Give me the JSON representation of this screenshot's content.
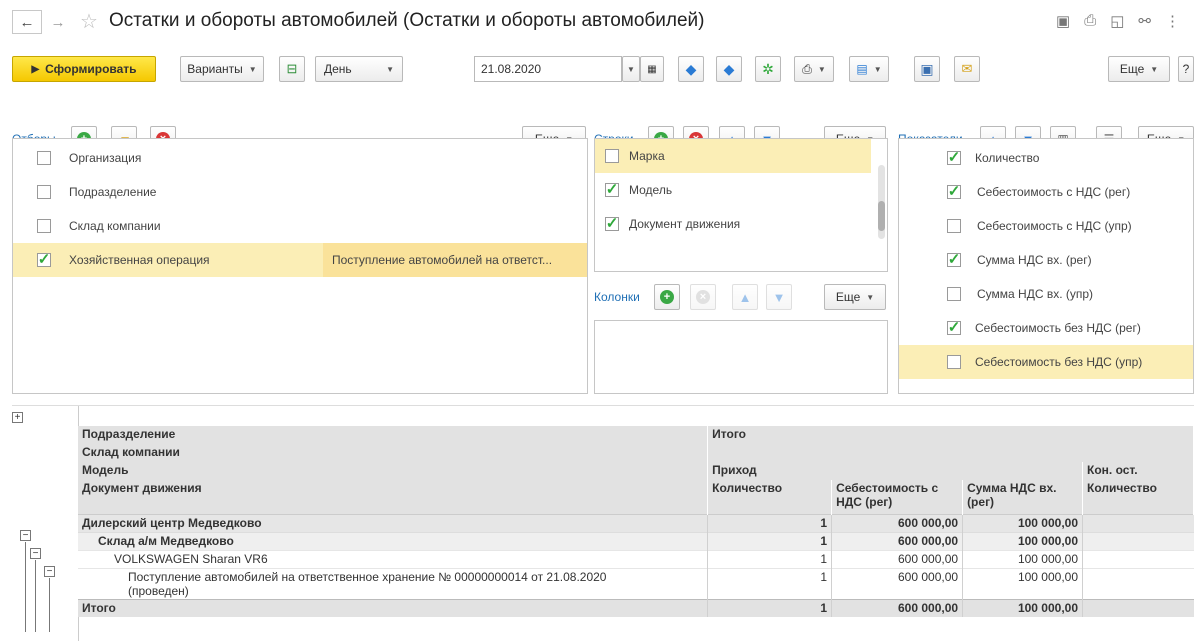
{
  "window": {
    "title": "Остатки и обороты автомобилей (Остатки и обороты автомобилей)"
  },
  "toolbar": {
    "generate_label": "Сформировать",
    "variants_label": "Варианты",
    "period_label": "День",
    "date_value": "21.08.2020",
    "more_label": "Еще",
    "help_label": "?"
  },
  "filters": {
    "header": "Отборы",
    "more_label": "Еще",
    "items": [
      {
        "label": "Организация",
        "checked": false,
        "value": ""
      },
      {
        "label": "Подразделение",
        "checked": false,
        "value": ""
      },
      {
        "label": "Склад компании",
        "checked": false,
        "value": ""
      },
      {
        "label": "Хозяйственная операция",
        "checked": true,
        "value": "Поступление автомобилей на ответст..."
      }
    ]
  },
  "rows_panel": {
    "header": "Строки",
    "more_label": "Еще",
    "items": [
      {
        "label": "Марка",
        "checked": false
      },
      {
        "label": "Модель",
        "checked": true
      },
      {
        "label": "Документ движения",
        "checked": true
      }
    ]
  },
  "columns_panel": {
    "header": "Колонки",
    "more_label": "Еще"
  },
  "indicators": {
    "header": "Показатели",
    "more_label": "Еще",
    "items": [
      {
        "label": "Количество",
        "checked": true
      },
      {
        "label": "Себестоимость с НДС (рег)",
        "checked": true
      },
      {
        "label": "Себестоимость с НДС (упр)",
        "checked": false
      },
      {
        "label": "Сумма НДС вх. (рег)",
        "checked": true
      },
      {
        "label": "Сумма НДС вх. (упр)",
        "checked": false
      },
      {
        "label": "Себестоимость без НДС (рег)",
        "checked": true
      },
      {
        "label": "Себестоимость без НДС (упр)",
        "checked": false
      }
    ]
  },
  "report": {
    "header_rows": {
      "r1_left": "Подразделение",
      "r1_right": "Итого",
      "r2_left": "Склад компании",
      "r3_left": "Модель",
      "r3_mid": "Приход",
      "r3_right": "Кон. ост.",
      "r4_left": "Документ движения",
      "col_qty": "Количество",
      "col_cost": "Себестоимость с НДС (рег)",
      "col_vat": "Сумма НДС вх. (рег)",
      "col_end_qty": "Количество"
    },
    "rows": [
      {
        "label": "Дилерский центр Медведково",
        "qty": "1",
        "cost": "600 000,00",
        "vat": "100 000,00"
      },
      {
        "label": "Склад а/м Медведково",
        "qty": "1",
        "cost": "600 000,00",
        "vat": "100 000,00"
      },
      {
        "label": "VOLKSWAGEN Sharan VR6",
        "qty": "1",
        "cost": "600 000,00",
        "vat": "100 000,00"
      },
      {
        "label": "Поступление автомобилей на ответственное хранение № 00000000014 от 21.08.2020 (проведен)",
        "qty": "1",
        "cost": "600 000,00",
        "vat": "100 000,00"
      }
    ],
    "total": {
      "label": "Итого",
      "qty": "1",
      "cost": "600 000,00",
      "vat": "100 000,00"
    }
  }
}
